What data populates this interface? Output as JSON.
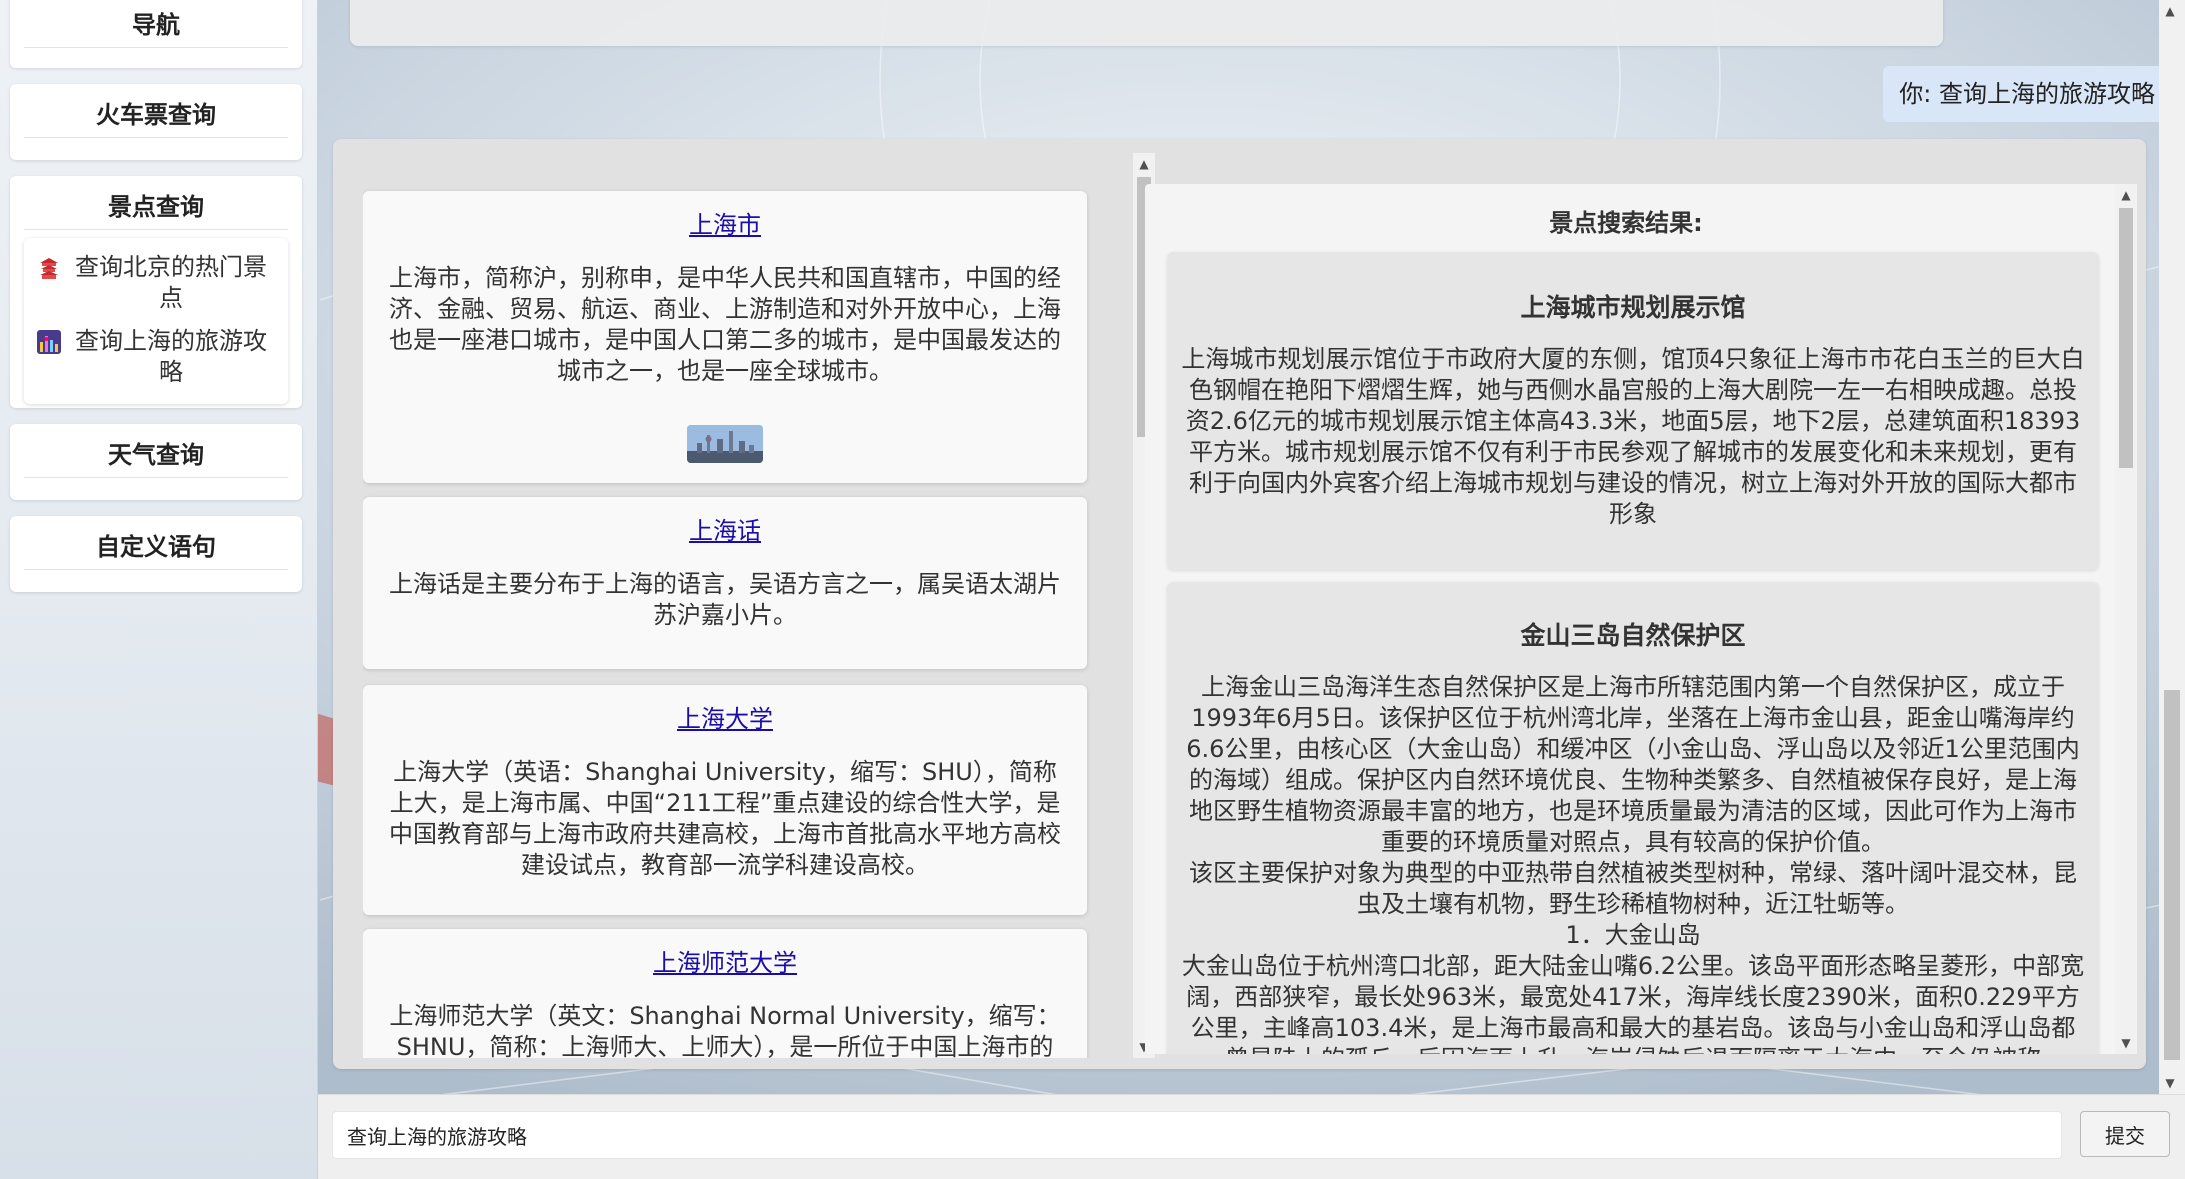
{
  "sidebar": {
    "sections": [
      {
        "title": "导航"
      },
      {
        "title": "火车票查询"
      },
      {
        "title": "景点查询",
        "items": [
          {
            "icon": "beijing-temple-icon",
            "label": "查询北京的热门景点"
          },
          {
            "icon": "shanghai-skyline-icon",
            "label": "查询上海的旅游攻略"
          }
        ]
      },
      {
        "title": "天气查询"
      },
      {
        "title": "自定义语句"
      }
    ]
  },
  "chat": {
    "user_message": "你: 查询上海的旅游攻略"
  },
  "wiki_results": [
    {
      "title": "上海市",
      "desc": "上海市，简称沪，别称申，是中华人民共和国直辖市，中国的经济、金融、贸易、航运、商业、上游制造和对外开放中心，上海也是一座港口城市，是中国人口第二多的城市，是中国最发达的城市之一，也是一座全球城市。",
      "has_thumb": true
    },
    {
      "title": "上海话",
      "desc": "上海话是主要分布于上海的语言，吴语方言之一，属吴语太湖片苏沪嘉小片。"
    },
    {
      "title": "上海大学",
      "desc": "上海大学（英语：Shanghai University，缩写：SHU），简称上大，是上海市属、中国“211工程”重点建设的综合性大学，是中国教育部与上海市政府共建高校，上海市首批高水平地方高校建设试点，教育部一流学科建设高校。"
    },
    {
      "title": "上海师范大学",
      "desc": "上海师范大学（英文：Shanghai Normal University，缩写：SHNU，简称：上海师大、上师大），是一所位于中国上海市的研"
    }
  ],
  "spots": {
    "header": "景点搜索结果:",
    "items": [
      {
        "name": "上海城市规划展示馆",
        "desc": "上海城市规划展示馆位于市政府大厦的东侧，馆顶4只象征上海市市花白玉兰的巨大白色钢帽在艳阳下熠熠生辉，她与西侧水晶宫般的上海大剧院一左一右相映成趣。总投资2.6亿元的城市规划展示馆主体高43.3米，地面5层，地下2层，总建筑面积18393平方米。城市规划展示馆不仅有利于市民参观了解城市的发展变化和未来规划，更有利于向国内外宾客介绍上海城市规划与建设的情况，树立上海对外开放的国际大都市形象"
      },
      {
        "name": "金山三岛自然保护区",
        "desc": "上海金山三岛海洋生态自然保护区是上海市所辖范围内第一个自然保护区，成立于1993年6月5日。该保护区位于杭州湾北岸，坐落在上海市金山县，距金山嘴海岸约6.6公里，由核心区（大金山岛）和缓冲区（小金山岛、浮山岛以及邻近1公里范围内的海域）组成。保护区内自然环境优良、生物种类繁多、自然植被保存良好，是上海地区野生植物资源最丰富的地方，也是环境质量最为清洁的区域，因此可作为上海市重要的环境质量对照点，具有较高的保护价值。\n该区主要保护对象为典型的中亚热带自然植被类型树种，常绿、落叶阔叶混交林，昆虫及土壤有机物，野生珍稀植物树种，近江牡蛎等。\n1．大金山岛\n大金山岛位于杭州湾口北部，距大陆金山嘴6.2公里。该岛平面形态略呈菱形，中部宽阔，西部狭窄，最长处963米，最宽处417米，海岸线长度2390米，面积0.229平方公里，主峰高103.4米，是上海市最高和最大的基岩岛。该岛与小金山岛和浮山岛都曾是陆上的孤丘，后因海面上升、海岸侵蚀后退而隔离于大海中，至今仍被称为“山”，平伏"
      }
    ]
  },
  "input": {
    "value": "查询上海的旅游攻略",
    "submit_label": "提交"
  }
}
